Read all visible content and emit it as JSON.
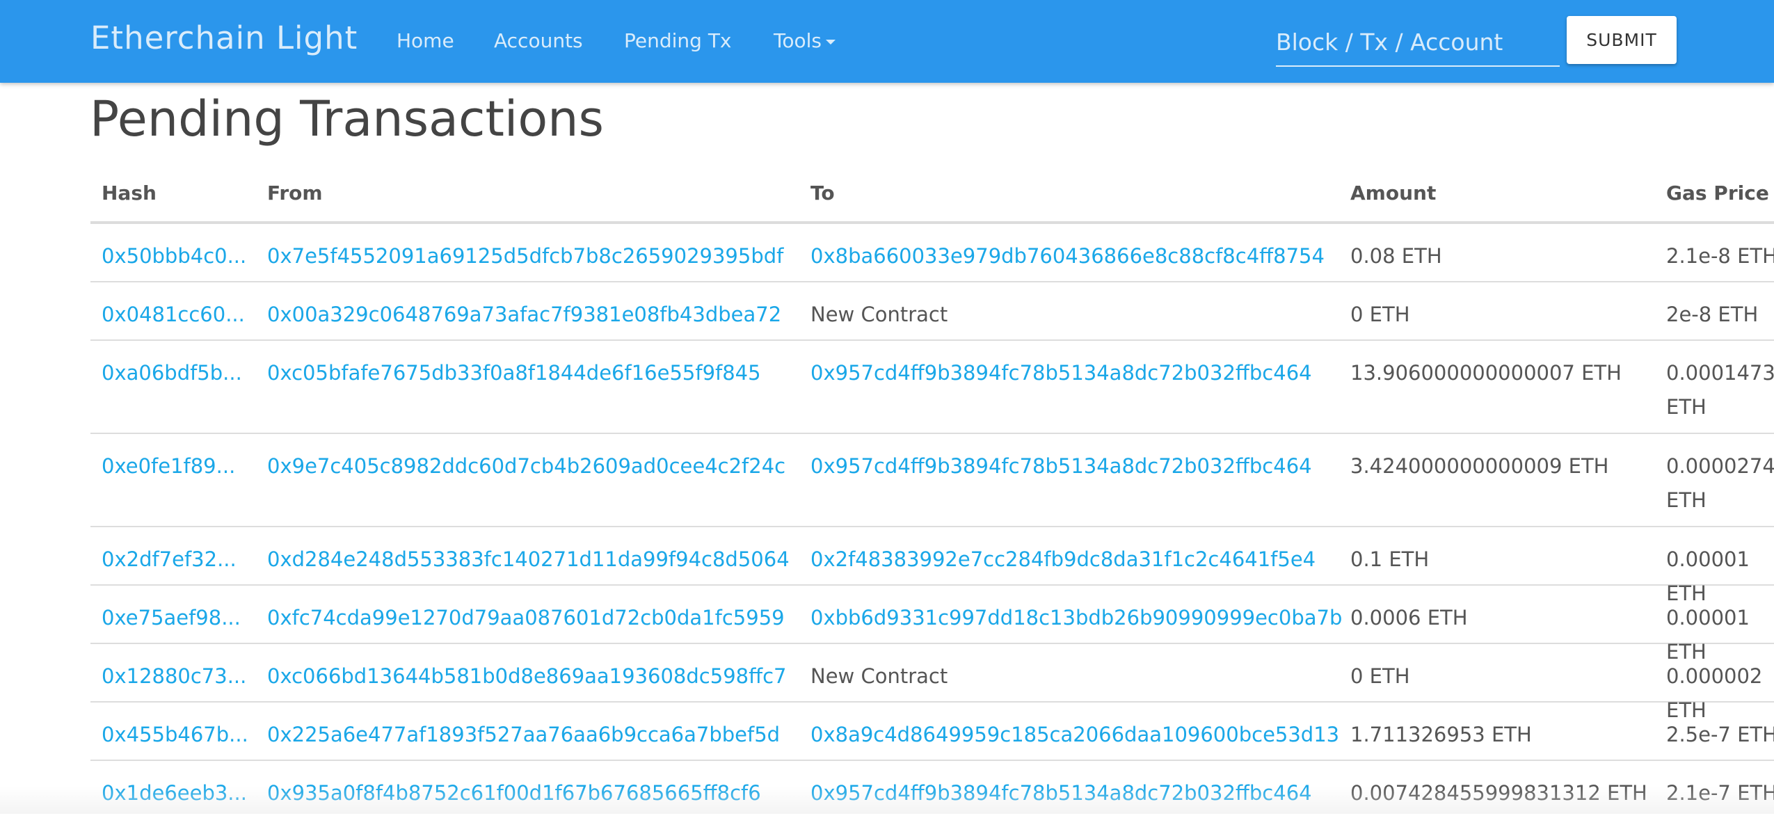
{
  "navbar": {
    "brand": "Etherchain Light",
    "links": [
      "Home",
      "Accounts",
      "Pending Tx",
      "Tools"
    ],
    "search_placeholder": "Block / Tx / Account",
    "search_value": "",
    "submit_label": "SUBMIT",
    "color": "#2b96ec"
  },
  "page": {
    "title": "Pending Transactions"
  },
  "table": {
    "headers": [
      "Hash",
      "From",
      "To",
      "Amount",
      "Gas Price"
    ],
    "rows": [
      {
        "hash": "0x50bbb4c0...",
        "from": "0x7e5f4552091a69125d5dfcb7b8c2659029395bdf",
        "to": "0x8ba660033e979db760436866e8c88cf8c4ff8754",
        "amount": "0.08 ETH",
        "gas": "2.1e-8 ETH"
      },
      {
        "hash": "0x0481cc60...",
        "from": "0x00a329c0648769a73afac7f9381e08fb43dbea72",
        "to": "New Contract",
        "amount": "0 ETH",
        "gas": "2e-8 ETH"
      },
      {
        "hash": "0xa06bdf5b...",
        "from": "0xc05bfafe7675db33f0a8f1844de6f16e55f9f845",
        "to": "0x957cd4ff9b3894fc78b5134a8dc72b032ffbc464",
        "amount": "13.906000000000007 ETH",
        "gas": "0.0001473 ETH"
      },
      {
        "hash": "0xe0fe1f89...",
        "from": "0x9e7c405c8982ddc60d7cb4b2609ad0cee4c2f24c",
        "to": "0x957cd4ff9b3894fc78b5134a8dc72b032ffbc464",
        "amount": "3.424000000000009 ETH",
        "gas": "0.0000274 ETH"
      },
      {
        "hash": "0x2df7ef32...",
        "from": "0xd284e248d553383fc140271d11da99f94c8d5064",
        "to": "0x2f48383992e7cc284fb9dc8da31f1c2c4641f5e4",
        "amount": "0.1 ETH",
        "gas": "0.00001 ETH"
      },
      {
        "hash": "0xe75aef98...",
        "from": "0xfc74cda99e1270d79aa087601d72cb0da1fc5959",
        "to": "0xbb6d9331c997dd18c13bdb26b90990999ec0ba7b",
        "amount": "0.0006 ETH",
        "gas": "0.00001 ETH"
      },
      {
        "hash": "0x12880c73...",
        "from": "0xc066bd13644b581b0d8e869aa193608dc598ffc7",
        "to": "New Contract",
        "amount": "0 ETH",
        "gas": "0.000002 ETH"
      },
      {
        "hash": "0x455b467b...",
        "from": "0x225a6e477af1893f527aa76aa6b9cca6a7bbef5d",
        "to": "0x8a9c4d8649959c185ca2066daa109600bce53d13",
        "amount": "1.711326953 ETH",
        "gas": "2.5e-7 ETH"
      },
      {
        "hash": "0x1de6eeb3...",
        "from": "0x935a0f8f4b8752c61f00d1f67b67685665ff8cf6",
        "to": "0x957cd4ff9b3894fc78b5134a8dc72b032ffbc464",
        "amount": "0.007428455999831312 ETH",
        "gas": "2.1e-7 ETH"
      }
    ]
  }
}
